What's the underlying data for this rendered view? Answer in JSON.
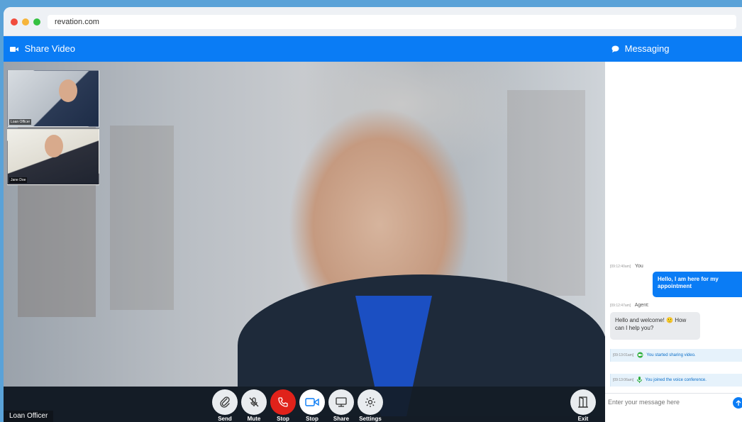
{
  "browser": {
    "url": "revation.com"
  },
  "video": {
    "header_title": "Share Video",
    "main_participant_label": "Loan Officer",
    "thumbnails": [
      {
        "label": "Loan Officer"
      },
      {
        "label": "Jane Doe"
      }
    ]
  },
  "controls": [
    {
      "label": "Send",
      "icon": "paperclip-icon"
    },
    {
      "label": "Mute",
      "icon": "microphone-off-icon"
    },
    {
      "label": "Stop",
      "icon": "phone-hangup-icon"
    },
    {
      "label": "Stop",
      "icon": "video-camera-icon"
    },
    {
      "label": "Share",
      "icon": "monitor-icon"
    },
    {
      "label": "Settings",
      "icon": "gear-icon"
    },
    {
      "label": "Exit",
      "icon": "door-exit-icon"
    }
  ],
  "messaging": {
    "header_title": "Messaging",
    "messages": [
      {
        "time": "[09:12:40am]",
        "sender": "You",
        "text": "Hello, I am here for my appointment"
      },
      {
        "time": "[09:12:47am]",
        "sender": "Agent:",
        "text": "Hello and welcome! 🙂 How can I help you?"
      }
    ],
    "notices": [
      {
        "time": "[09:13:01am]",
        "text": "You started sharing video.",
        "icon": "video-share-icon"
      },
      {
        "time": "[09:13:06am]",
        "text": "You joined the voice conference.",
        "icon": "microphone-icon"
      }
    ],
    "input_placeholder": "Enter your message here"
  },
  "colors": {
    "accent": "#0a7cf5",
    "hangup": "#e0221a",
    "background": "#5aa2d8"
  }
}
